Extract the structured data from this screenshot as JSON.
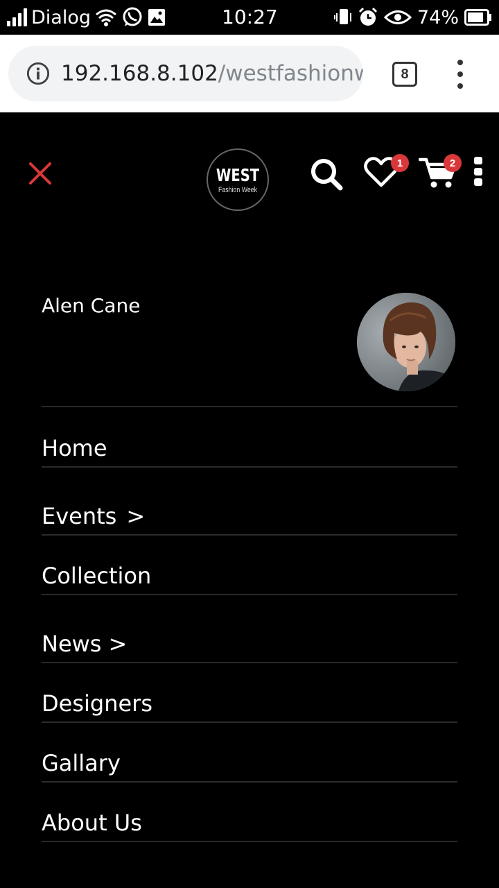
{
  "status_bar": {
    "carrier": "Dialog",
    "time": "10:27",
    "battery": "74%"
  },
  "browser": {
    "url_host": "192.168.8.102",
    "url_path": "/westfashionw",
    "tab_count": "8"
  },
  "header": {
    "logo_main": "WEST",
    "logo_sub": "Fashion Week",
    "wishlist_count": "1",
    "cart_count": "2",
    "accent_color": "#d9383a"
  },
  "profile": {
    "name": "Alen Cane"
  },
  "nav": {
    "items": [
      {
        "label": "Home",
        "arrow": ""
      },
      {
        "label": "Events",
        "arrow": ">"
      },
      {
        "label": "Collection",
        "arrow": ""
      },
      {
        "label": "News",
        "arrow": ">"
      },
      {
        "label": "Designers",
        "arrow": ""
      },
      {
        "label": "Gallary",
        "arrow": ""
      },
      {
        "label": "About Us",
        "arrow": ""
      }
    ]
  }
}
